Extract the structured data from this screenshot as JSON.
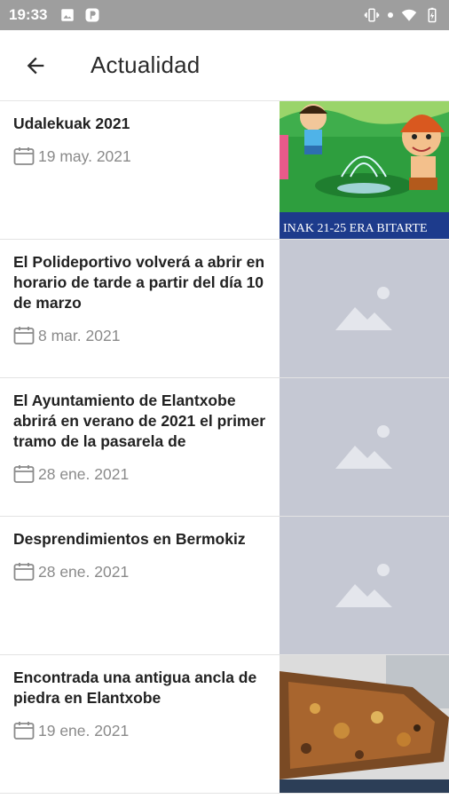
{
  "status_bar": {
    "time": "19:33",
    "left_icons": [
      "image-icon",
      "parking-icon"
    ],
    "right_icons": [
      "vibrate-icon",
      "dot-icon",
      "wifi-icon",
      "battery-icon"
    ]
  },
  "app_bar": {
    "back_icon": "arrow-back-icon",
    "title": "Actualidad"
  },
  "news": [
    {
      "title": "Udalekuak 2021",
      "date": "19 may. 2021",
      "thumb": "camp-illustration",
      "thumb_caption": "INAK 21-25 ERA BITARTE"
    },
    {
      "title": "El Polideportivo volverá a abrir en horario de tarde a partir del día 10 de marzo",
      "date": "8 mar. 2021",
      "thumb": "placeholder-image"
    },
    {
      "title": "El Ayuntamiento de Elantxobe abrirá en verano de 2021 el primer tramo de la pasarela de",
      "date": "28 ene. 2021",
      "thumb": "placeholder-image"
    },
    {
      "title": "Desprendimientos en Bermokiz",
      "date": "28 ene. 2021",
      "thumb": "placeholder-image"
    },
    {
      "title": "Encontrada una antigua ancla de piedra en Elantxobe",
      "date": "19 ene. 2021",
      "thumb": "stone-anchor-photo"
    }
  ],
  "colors": {
    "status_bar": "#9e9e9e",
    "placeholder": "#c5c8d3",
    "date_text": "#8a8a8a"
  }
}
